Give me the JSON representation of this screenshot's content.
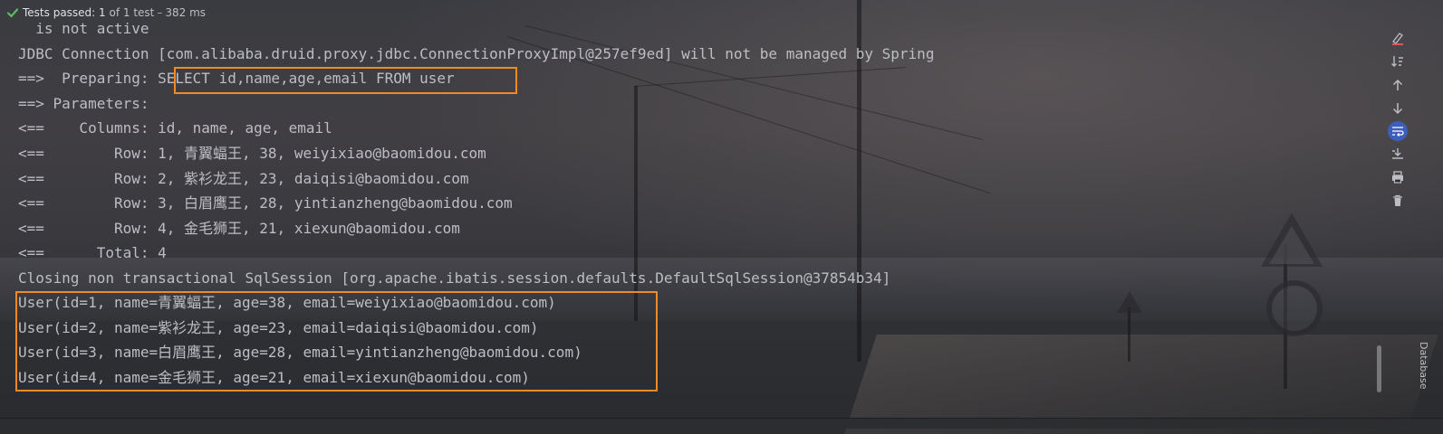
{
  "status": {
    "label": "Tests passed:",
    "count": "1",
    "of_text": "of 1 test",
    "separator": "–",
    "duration": "382 ms",
    "check_color": "#5fb865"
  },
  "console": {
    "lines": [
      "  is not active",
      "JDBC Connection [com.alibaba.druid.proxy.jdbc.ConnectionProxyImpl@257ef9ed] will not be managed by Spring",
      "==>  Preparing: SELECT id,name,age,email FROM user",
      "==> Parameters: ",
      "<==    Columns: id, name, age, email",
      "<==        Row: 1, 青翼蝠王, 38, weiyixiao@baomidou.com",
      "<==        Row: 2, 紫衫龙王, 23, daiqisi@baomidou.com",
      "<==        Row: 3, 白眉鹰王, 28, yintianzheng@baomidou.com",
      "<==        Row: 4, 金毛狮王, 21, xiexun@baomidou.com",
      "<==      Total: 4",
      "Closing non transactional SqlSession [org.apache.ibatis.session.defaults.DefaultSqlSession@37854b34]",
      "User(id=1, name=青翼蝠王, age=38, email=weiyixiao@baomidou.com)",
      "User(id=2, name=紫衫龙王, age=23, email=daiqisi@baomidou.com)",
      "User(id=3, name=白眉鹰王, age=28, email=yintianzheng@baomidou.com)",
      "User(id=4, name=金毛狮王, age=21, email=xiexun@baomidou.com)"
    ],
    "highlight_color": "#f08a24"
  },
  "toolbar": {
    "icons": [
      "clear-all-icon",
      "sort-icon",
      "up-arrow-icon",
      "down-arrow-icon",
      "soft-wrap-icon",
      "scroll-to-end-icon",
      "print-icon",
      "trash-icon"
    ]
  },
  "side_tab": {
    "label": "Database"
  }
}
